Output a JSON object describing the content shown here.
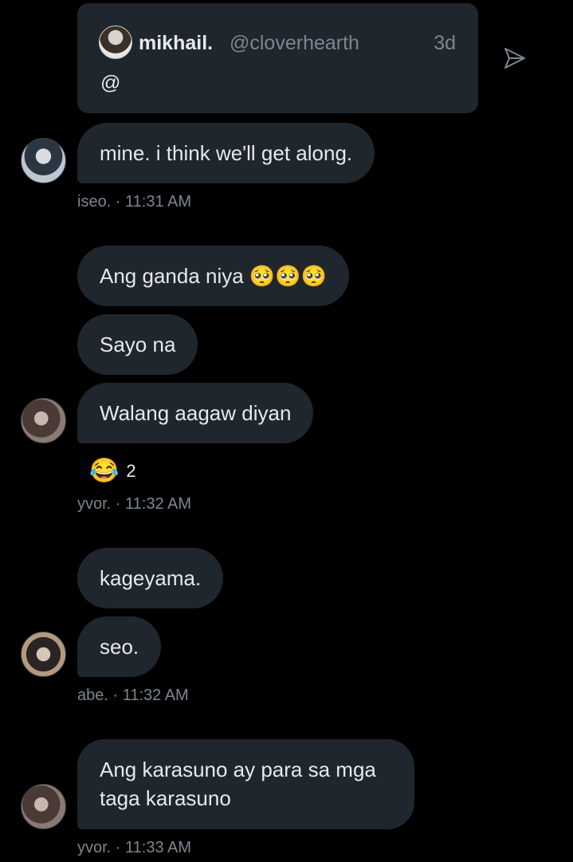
{
  "quote": {
    "name": "mikhail.",
    "handle": "@cloverhearth",
    "time": "3d",
    "text": "@"
  },
  "messages": [
    {
      "text": "mine. i think we'll get along."
    },
    {
      "text": "Ang ganda niya 🥺🥺🥺"
    },
    {
      "text": "Sayo na"
    },
    {
      "text": "Walang aagaw diyan"
    },
    {
      "text": "kageyama."
    },
    {
      "text": "seo."
    },
    {
      "text": "Ang karasuno ay para sa mga taga karasuno"
    }
  ],
  "meta": {
    "iseo": "iseo. · 11:31 AM",
    "yvor1": "yvor. · 11:32 AM",
    "abe": "abe. · 11:32 AM",
    "yvor2": "yvor. · 11:33 AM"
  },
  "reaction": {
    "emoji": "😂",
    "count": "2"
  },
  "icons": {
    "share": "paper-plane-icon"
  },
  "colors": {
    "background": "#000000",
    "bubble": "#1f262d",
    "text": "#e7e9ea",
    "muted": "#7b8690"
  }
}
